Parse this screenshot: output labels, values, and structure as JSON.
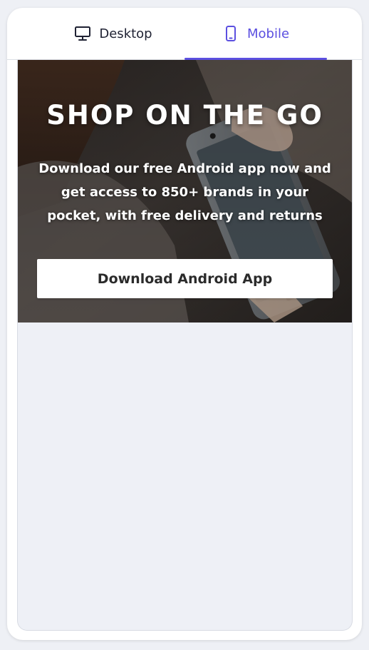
{
  "tabs": {
    "desktop": {
      "label": "Desktop",
      "icon": "desktop-monitor-icon",
      "active": false
    },
    "mobile": {
      "label": "Mobile",
      "icon": "mobile-phone-icon",
      "active": true
    }
  },
  "banner": {
    "title": "SHOP ON THE GO",
    "text": "Download our free Android app now and get access to 850+ brands in your pocket, with free delivery and returns",
    "button_label": "Download Android App",
    "background_image": "woman-holding-smartphone-photo"
  },
  "colors": {
    "accent": "#5b4fe0",
    "text_dark": "#1f2233",
    "preview_background": "#eef0f6"
  }
}
